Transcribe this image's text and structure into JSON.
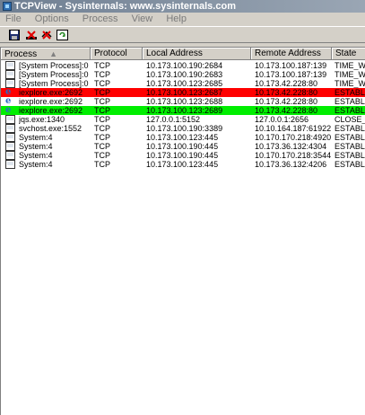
{
  "window": {
    "title": "TCPView - Sysinternals: www.sysinternals.com"
  },
  "menu": {
    "items": [
      "File",
      "Options",
      "Process",
      "View",
      "Help"
    ]
  },
  "toolbar": {
    "buttons": [
      "save-icon",
      "stop-a-icon",
      "stop-b-icon",
      "refresh-icon"
    ]
  },
  "columns": {
    "process": "Process",
    "protocol": "Protocol",
    "local": "Local Address",
    "remote": "Remote Address",
    "state": "State"
  },
  "rows": [
    {
      "process": "[System Process]:0",
      "protocol": "TCP",
      "local": "10.173.100.190:2684",
      "remote": "10.173.100.187:139",
      "state": "TIME_WAIT",
      "icon": "monitor-icon",
      "highlight": ""
    },
    {
      "process": "[System Process]:0",
      "protocol": "TCP",
      "local": "10.173.100.190:2683",
      "remote": "10.173.100.187:139",
      "state": "TIME_WAIT",
      "icon": "monitor-icon",
      "highlight": ""
    },
    {
      "process": "[System Process]:0",
      "protocol": "TCP",
      "local": "10.173.100.123:2685",
      "remote": "10.173.42.228:80",
      "state": "TIME_WAIT",
      "icon": "monitor-icon",
      "highlight": ""
    },
    {
      "process": "iexplore.exe:2692",
      "protocol": "TCP",
      "local": "10.173.100.123:2687",
      "remote": "10.173.42.228:80",
      "state": "ESTABLISHED",
      "icon": "ie-icon",
      "highlight": "red"
    },
    {
      "process": "iexplore.exe:2692",
      "protocol": "TCP",
      "local": "10.173.100.123:2688",
      "remote": "10.173.42.228:80",
      "state": "ESTABLISHED",
      "icon": "ie-icon",
      "highlight": ""
    },
    {
      "process": "iexplore.exe:2692",
      "protocol": "TCP",
      "local": "10.173.100.123:2689",
      "remote": "10.173.42.228:80",
      "state": "ESTABLISHED",
      "icon": "ie-icon",
      "highlight": "green"
    },
    {
      "process": "jqs.exe:1340",
      "protocol": "TCP",
      "local": "127.0.0.1:5152",
      "remote": "127.0.0.1:2656",
      "state": "CLOSE_WAIT",
      "icon": "monitor-icon",
      "highlight": ""
    },
    {
      "process": "svchost.exe:1552",
      "protocol": "TCP",
      "local": "10.173.100.190:3389",
      "remote": "10.10.164.187:61922",
      "state": "ESTABLISHED",
      "icon": "monitor-icon",
      "highlight": ""
    },
    {
      "process": "System:4",
      "protocol": "TCP",
      "local": "10.173.100.123:445",
      "remote": "10.170.170.218:4920",
      "state": "ESTABLISHED",
      "icon": "monitor-icon",
      "highlight": ""
    },
    {
      "process": "System:4",
      "protocol": "TCP",
      "local": "10.173.100.190:445",
      "remote": "10.173.36.132:4304",
      "state": "ESTABLISHED",
      "icon": "monitor-icon",
      "highlight": ""
    },
    {
      "process": "System:4",
      "protocol": "TCP",
      "local": "10.173.100.190:445",
      "remote": "10.170.170.218:3544",
      "state": "ESTABLISHED",
      "icon": "monitor-icon",
      "highlight": ""
    },
    {
      "process": "System:4",
      "protocol": "TCP",
      "local": "10.173.100.123:445",
      "remote": "10.173.36.132:4206",
      "state": "ESTABLISHED",
      "icon": "monitor-icon",
      "highlight": ""
    }
  ]
}
